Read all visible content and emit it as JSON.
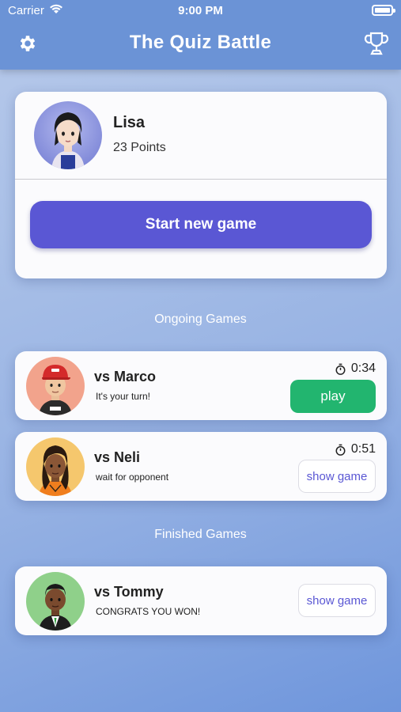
{
  "status_bar": {
    "carrier": "Carrier",
    "time": "9:00 PM"
  },
  "header": {
    "title": "The Quiz Battle",
    "left_icon": "gear-icon",
    "right_icon": "trophy-icon"
  },
  "profile": {
    "name": "Lisa",
    "points": "23 Points",
    "start_button": "Start new game"
  },
  "sections": {
    "ongoing": "Ongoing Games",
    "finished": "Finished Games"
  },
  "ongoing_games": [
    {
      "opponent": "vs Marco",
      "status": "It's your turn!",
      "timer": "0:34",
      "action": "play"
    },
    {
      "opponent": "vs Neli",
      "status": "wait for opponent",
      "timer": "0:51",
      "action": "show game"
    }
  ],
  "finished_games": [
    {
      "opponent": "vs Tommy",
      "status": "CONGRATS YOU WON!",
      "action": "show game"
    }
  ],
  "colors": {
    "header": "#6b93d6",
    "primary": "#5a57d4",
    "play": "#22b56f"
  }
}
